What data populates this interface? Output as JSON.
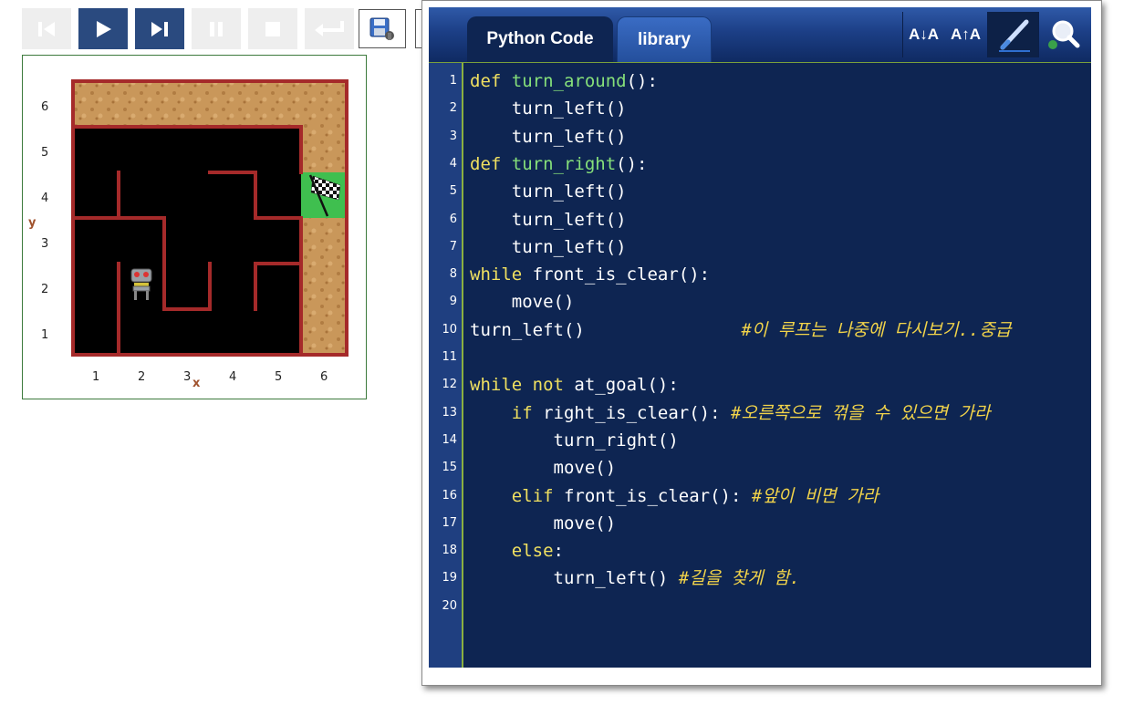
{
  "toolbar": {
    "buttons": [
      {
        "name": "first-step-button",
        "icon": "skip-to-start-icon",
        "state": "disabled"
      },
      {
        "name": "run-button",
        "icon": "play-icon",
        "state": "active"
      },
      {
        "name": "step-button",
        "icon": "step-forward-icon",
        "state": "active"
      },
      {
        "name": "pause-button",
        "icon": "pause-icon",
        "state": "disabled"
      },
      {
        "name": "stop-button",
        "icon": "stop-icon",
        "state": "disabled"
      },
      {
        "name": "reset-button",
        "icon": "return-icon",
        "state": "disabled"
      }
    ],
    "save_icon": "save-world-icon"
  },
  "world": {
    "x_axis_label": "x",
    "y_axis_label": "y",
    "x_ticks": [
      "1",
      "2",
      "3",
      "4",
      "5",
      "6"
    ],
    "y_ticks": [
      "6",
      "5",
      "4",
      "3",
      "2",
      "1"
    ],
    "robot_icon": "robot-icon",
    "goal_icon": "checkered-flag-icon",
    "colors": {
      "wall": "#a52a2a",
      "sand": "#c9975a",
      "floor": "#000000",
      "goal": "#3fbf4f"
    }
  },
  "editor": {
    "tabs": [
      {
        "label": "Python Code",
        "active": true
      },
      {
        "label": "library",
        "active": false
      }
    ],
    "tools": {
      "font_down_label": "A↓A",
      "font_up_label": "A↑A"
    },
    "lines": [
      {
        "n": "1",
        "segs": [
          {
            "c": "kw",
            "t": "def "
          },
          {
            "c": "fn",
            "t": "turn_around"
          },
          {
            "c": "normal",
            "t": "():"
          }
        ]
      },
      {
        "n": "2",
        "segs": [
          {
            "c": "normal",
            "t": "    turn_left()"
          }
        ]
      },
      {
        "n": "3",
        "segs": [
          {
            "c": "normal",
            "t": "    turn_left()"
          }
        ]
      },
      {
        "n": "4",
        "segs": [
          {
            "c": "kw",
            "t": "def "
          },
          {
            "c": "fn",
            "t": "turn_right"
          },
          {
            "c": "normal",
            "t": "():"
          }
        ]
      },
      {
        "n": "5",
        "segs": [
          {
            "c": "normal",
            "t": "    turn_left()"
          }
        ]
      },
      {
        "n": "6",
        "segs": [
          {
            "c": "normal",
            "t": "    turn_left()"
          }
        ]
      },
      {
        "n": "7",
        "segs": [
          {
            "c": "normal",
            "t": "    turn_left()"
          }
        ]
      },
      {
        "n": "8",
        "segs": [
          {
            "c": "kw",
            "t": "while "
          },
          {
            "c": "normal",
            "t": "front_is_clear():"
          }
        ]
      },
      {
        "n": "9",
        "segs": [
          {
            "c": "normal",
            "t": "    move()"
          }
        ]
      },
      {
        "n": "10",
        "segs": [
          {
            "c": "normal",
            "t": "turn_left()               "
          },
          {
            "c": "cm",
            "t": "#이 루프는 나중에 다시보기..중급"
          }
        ]
      },
      {
        "n": "11",
        "segs": []
      },
      {
        "n": "12",
        "segs": [
          {
            "c": "kw",
            "t": "while not "
          },
          {
            "c": "normal",
            "t": "at_goal():"
          }
        ]
      },
      {
        "n": "13",
        "segs": [
          {
            "c": "normal",
            "t": "    "
          },
          {
            "c": "kw",
            "t": "if "
          },
          {
            "c": "normal",
            "t": "right_is_clear(): "
          },
          {
            "c": "cm",
            "t": "#오른쪽으로 꺾을 수 있으면 가라"
          }
        ]
      },
      {
        "n": "14",
        "segs": [
          {
            "c": "normal",
            "t": "        turn_right()"
          }
        ]
      },
      {
        "n": "15",
        "segs": [
          {
            "c": "normal",
            "t": "        move()"
          }
        ]
      },
      {
        "n": "16",
        "segs": [
          {
            "c": "normal",
            "t": "    "
          },
          {
            "c": "kw",
            "t": "elif "
          },
          {
            "c": "normal",
            "t": "front_is_clear(): "
          },
          {
            "c": "cm",
            "t": "#앞이 비면 가라"
          }
        ]
      },
      {
        "n": "17",
        "segs": [
          {
            "c": "normal",
            "t": "        move()"
          }
        ]
      },
      {
        "n": "18",
        "segs": [
          {
            "c": "normal",
            "t": "    "
          },
          {
            "c": "kw",
            "t": "else"
          },
          {
            "c": "normal",
            "t": ":"
          }
        ]
      },
      {
        "n": "19",
        "segs": [
          {
            "c": "normal",
            "t": "        turn_left() "
          },
          {
            "c": "cm",
            "t": "#길을 찾게 함."
          }
        ]
      },
      {
        "n": "20",
        "segs": []
      }
    ]
  }
}
